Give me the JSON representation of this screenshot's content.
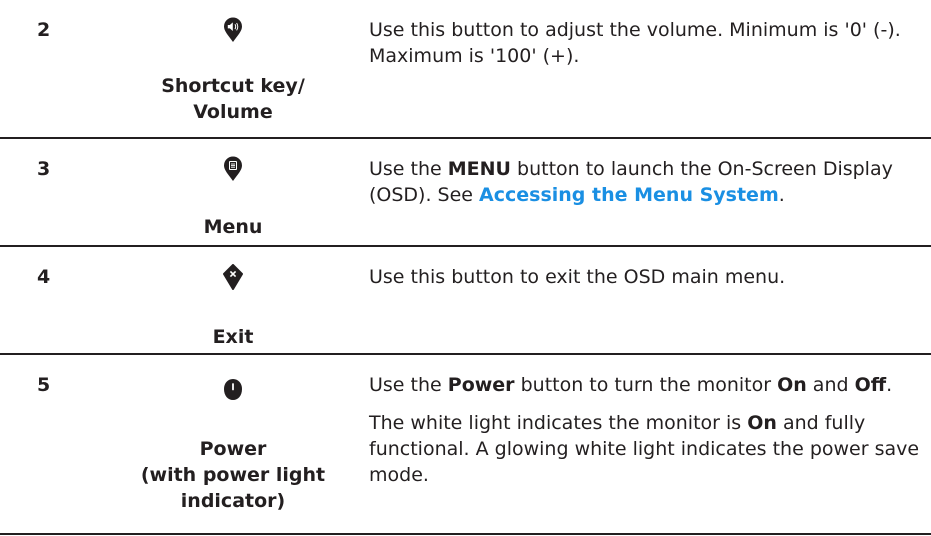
{
  "rows": [
    {
      "number": "2",
      "icon": "volume-icon",
      "label_line1": "Shortcut key/",
      "label_line2": "Volume",
      "description": "Use this button to adjust the volume. Minimum is '0' (-). Maximum is '100' (+)."
    },
    {
      "number": "3",
      "icon": "menu-icon",
      "label_line1": "Menu",
      "desc_pre": "Use the ",
      "desc_bold": "MENU",
      "desc_mid": " button to launch the On-Screen Display (OSD). See ",
      "desc_link": "Accessing the Menu System",
      "desc_post": "."
    },
    {
      "number": "4",
      "icon": "exit-icon",
      "label_line1": "Exit",
      "description": "Use this button to exit the OSD main menu."
    },
    {
      "number": "5",
      "icon": "power-icon",
      "label_line1": "Power",
      "label_line2": "(with power light",
      "label_line3": "indicator)",
      "p1_pre": "Use the ",
      "p1_bold1": "Power",
      "p1_mid": " button to turn the monitor ",
      "p1_bold2": "On",
      "p1_and": " and ",
      "p1_bold3": "Off",
      "p1_post": ".",
      "p2_pre": "The white light indicates the monitor is ",
      "p2_bold": "On",
      "p2_post": " and fully functional. A glowing white light indicates the power save mode."
    }
  ]
}
